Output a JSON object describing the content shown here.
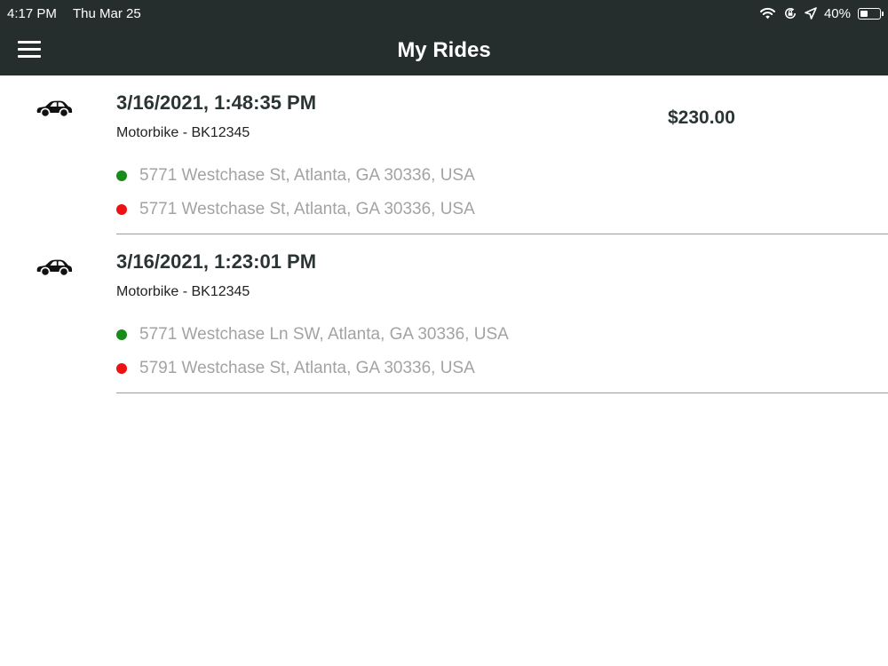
{
  "status_bar": {
    "time": "4:17 PM",
    "date": "Thu Mar 25",
    "battery_percent": "40%",
    "battery_level": 0.4,
    "icons": [
      "wifi-icon",
      "rotation-lock-icon",
      "location-arrow-icon",
      "battery-icon"
    ]
  },
  "header": {
    "title": "My Rides",
    "menu_icon": "hamburger-menu-icon",
    "background_color": "#252d2d"
  },
  "colors": {
    "pickup_dot": "#1a8a1a",
    "dropoff_dot": "#ee1111",
    "address_text": "#a3a3a3"
  },
  "rides": [
    {
      "icon": "car-icon",
      "datetime": "3/16/2021, 1:48:35 PM",
      "vehicle": "Motorbike - BK12345",
      "price": "$230.00",
      "pickup": "5771 Westchase St, Atlanta, GA 30336, USA",
      "dropoff": "5771 Westchase St, Atlanta, GA 30336, USA"
    },
    {
      "icon": "car-icon",
      "datetime": "3/16/2021, 1:23:01 PM",
      "vehicle": "Motorbike - BK12345",
      "price": "",
      "pickup": "5771 Westchase Ln SW, Atlanta, GA 30336, USA",
      "dropoff": "5791 Westchase St, Atlanta, GA 30336, USA"
    }
  ]
}
